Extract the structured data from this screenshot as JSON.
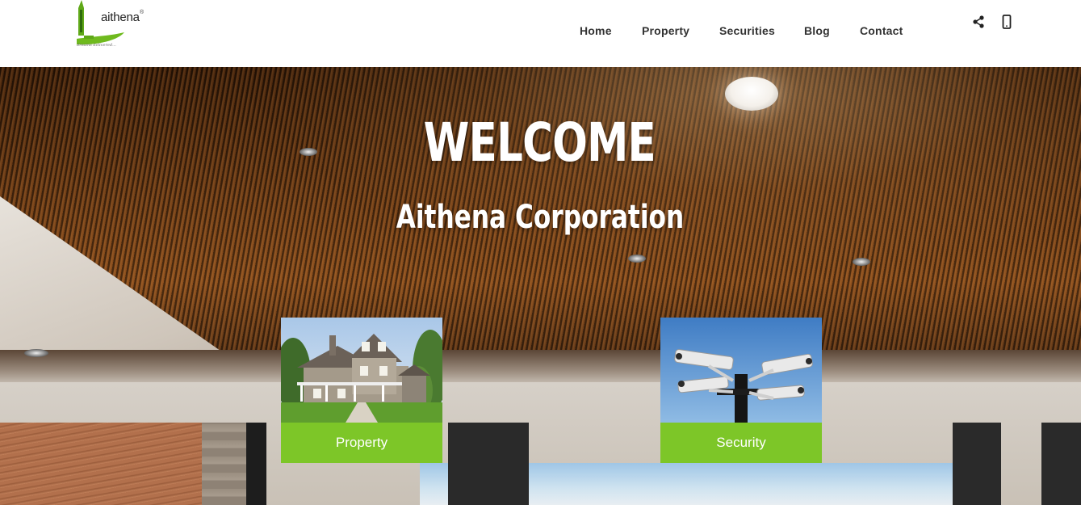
{
  "header": {
    "logo": {
      "name": "aithena",
      "registered_mark": "®",
      "tagline": "dreams delivered..."
    },
    "nav": [
      {
        "label": "Home"
      },
      {
        "label": "Property"
      },
      {
        "label": "Securities"
      },
      {
        "label": "Blog"
      },
      {
        "label": "Contact"
      }
    ],
    "icons": [
      "share-icon",
      "mobile-phone-icon"
    ]
  },
  "hero": {
    "title": "WELCOME",
    "subtitle": "Aithena Corporation",
    "cards": [
      {
        "label": "Property",
        "image": "house-photo"
      },
      {
        "label": "Security",
        "image": "security-cameras-photo"
      }
    ]
  },
  "colors": {
    "accent_green": "#7dc628",
    "nav_text": "#333333",
    "logo_green": "#6fba1e"
  }
}
